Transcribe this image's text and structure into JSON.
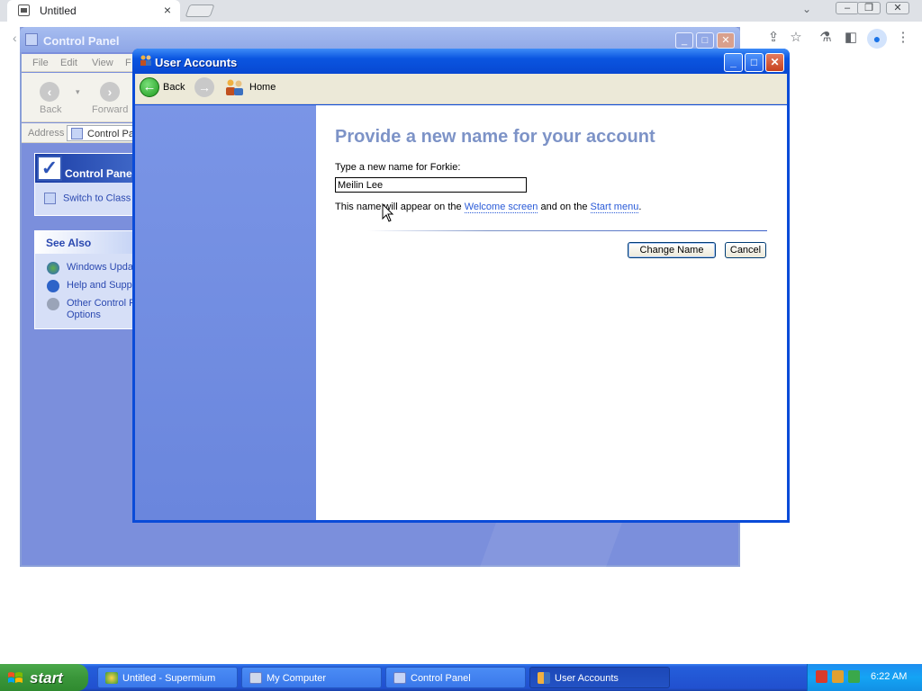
{
  "browser": {
    "tab_title": "Untitled",
    "tab_close": "×",
    "dropdown": "⌄",
    "window_controls": {
      "minimize": "–",
      "restore": "❐",
      "close": "✕"
    },
    "toolbar_icons": [
      "share-icon",
      "star-icon",
      "flask-icon",
      "sidebar-icon",
      "profile-icon",
      "menu-icon"
    ]
  },
  "control_panel": {
    "title": "Control Panel",
    "menu": [
      "File",
      "Edit",
      "View",
      "F"
    ],
    "nav_back": "Back",
    "nav_forward": "Forward",
    "address_label": "Address",
    "address_value": "Control Pa",
    "panel_title": "Control Panel",
    "switch_view": "Switch to Class",
    "see_also_title": "See Also",
    "see_also": [
      "Windows Updat",
      "Help and Suppo",
      "Other Control P",
      "Options"
    ]
  },
  "user_accounts": {
    "title": "User Accounts",
    "back_label": "Back",
    "home_label": "Home",
    "heading": "Provide a new name for your account",
    "prompt": "Type a new name for Forkie:",
    "name_value": "Meilin Lee",
    "note_prefix": "This name will appear on the ",
    "note_link1": "Welcome screen",
    "note_middle": " and on the ",
    "note_link2": "Start menu",
    "note_suffix": ".",
    "change_name_button": "Change Name",
    "cancel_button": "Cancel"
  },
  "taskbar": {
    "start": "start",
    "tasks": [
      {
        "label": "Untitled - Supermium",
        "icon": "browser-icon"
      },
      {
        "label": "My Computer",
        "icon": "computer-icon"
      },
      {
        "label": "Control Panel",
        "icon": "control-panel-icon"
      },
      {
        "label": "User Accounts",
        "icon": "user-accounts-icon"
      }
    ],
    "clock": "6:22 AM"
  },
  "colors": {
    "xp_blue": "#0a4bd8",
    "heading": "#7d93c7",
    "link": "#2a5bd8",
    "taskbar": "#245edb",
    "start_green": "#3a963a"
  }
}
